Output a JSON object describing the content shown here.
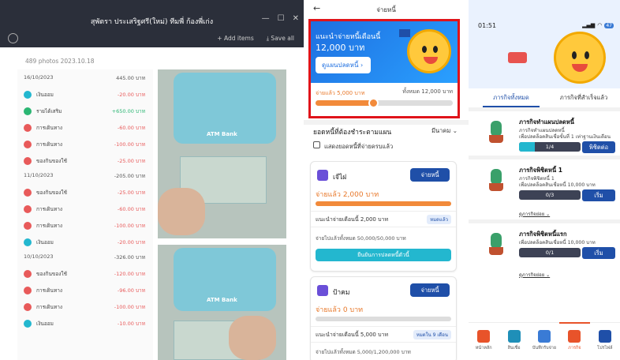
{
  "panel1": {
    "title": "สุพัตรา ประเสริฐศรี(ใหม่) ทีมพี่ ก้องพี่เก่ง",
    "window_controls": [
      "—",
      "☐",
      "✕"
    ],
    "add_items": "+ Add items",
    "save_all": "⤓ Save all",
    "subtitle": "489 photos 2023.10.18",
    "transactions": [
      {
        "kind": "date",
        "date": "16/10/2023",
        "total": "445.00 บาท"
      },
      {
        "kind": "tx",
        "label": "เงินออม",
        "amount": "-20.00 บาท",
        "color": "#23b7cf"
      },
      {
        "kind": "tx",
        "label": "รายได้เสริม",
        "amount": "+650.00 บาท",
        "color": "#2bb673"
      },
      {
        "kind": "tx",
        "label": "การเดินทาง",
        "amount": "-60.00 บาท",
        "color": "#e85a5a"
      },
      {
        "kind": "tx",
        "label": "การเดินทาง",
        "amount": "-100.00 บาท",
        "color": "#e85a5a"
      },
      {
        "kind": "tx",
        "label": "ของกินของใช้",
        "amount": "-25.00 บาท",
        "color": "#e85a5a"
      },
      {
        "kind": "date",
        "date": "11/10/2023",
        "total": "-205.00 บาท"
      },
      {
        "kind": "tx",
        "label": "ของกินของใช้",
        "amount": "-25.00 บาท",
        "color": "#e85a5a"
      },
      {
        "kind": "tx",
        "label": "การเดินทาง",
        "amount": "-60.00 บาท",
        "color": "#e85a5a"
      },
      {
        "kind": "tx",
        "label": "การเดินทาง",
        "amount": "-100.00 บาท",
        "color": "#e85a5a"
      },
      {
        "kind": "tx",
        "label": "เงินออม",
        "amount": "-20.00 บาท",
        "color": "#23b7cf"
      },
      {
        "kind": "date",
        "date": "10/10/2023",
        "total": "-326.00 บาท"
      },
      {
        "kind": "tx",
        "label": "ของกินของใช้",
        "amount": "-120.00 บาท",
        "color": "#e85a5a"
      },
      {
        "kind": "tx",
        "label": "การเดินทาง",
        "amount": "-96.00 บาท",
        "color": "#e85a5a"
      },
      {
        "kind": "tx",
        "label": "การเดินทาง",
        "amount": "-100.00 บาท",
        "color": "#e85a5a"
      },
      {
        "kind": "tx",
        "label": "เงินออม",
        "amount": "-10.00 บาท",
        "color": "#23b7cf"
      }
    ],
    "photo_brand": "ATM Bank"
  },
  "panel2": {
    "back": "←",
    "title": "จ่ายหนี้",
    "hero_heading": "แนะนำจ่ายหนี้เดือนนี้",
    "hero_amount": "12,000 บาท",
    "hero_button": "ดูแผนปลดหนี้ ›",
    "hero_paid": "จ่ายแล้ว 5,000 บาท",
    "hero_total": "ทั้งหมด 12,000 บาท",
    "hero_progress": 0.42,
    "section_title": "ยอดหนี้ที่ต้องชำระตามแผน",
    "month_dropdown": "มีนาคม ⌄",
    "checkbox_label": "แสดงยอดหนี้ที่จ่ายครบแล้ว",
    "debts": [
      {
        "name": "เจ๊ไฝ",
        "pay_button": "จ่ายหนี้",
        "paid": "จ่ายแล้ว 2,000 บาท",
        "progress": 1.0,
        "advice": "แนะนำจ่ายเดือนนี้ 2,000 บาท",
        "tag": "หมดแล้ว",
        "remaining": "จ่ายไปแล้วทั้งหมด 50,000/50,000 บาท",
        "confirm": "ยืนยันการปลดหนี้ตัวนี้"
      },
      {
        "name": "ป้าคม",
        "pay_button": "จ่ายหนี้",
        "paid": "จ่ายแล้ว 0 บาท",
        "progress": 0.0,
        "advice": "แนะนำจ่ายเดือนนี้ 5,000 บาท",
        "tag": "หมดใน 9 เดือน",
        "remaining": "จ่ายไปแล้วทั้งหมด 5,000/1,200,000 บาท"
      }
    ]
  },
  "panel3": {
    "time": "01:51",
    "battery": "47",
    "tabs": [
      "ภารกิจทั้งหมด",
      "ภารกิจที่สำเร็จแล้ว"
    ],
    "missions": [
      {
        "title": "ภารกิจทำแผนปลดหนี้",
        "lines": [
          "ภารกิจทำแผนปลดหนี้",
          "เพื่อปลดล็อคสินเชื่อขั้นที่ 1 เท่าฐานเงินเดือน"
        ],
        "progress_text": "1/4",
        "progress": 0.25,
        "button": "พิชิตต่อ"
      },
      {
        "title": "ภารกิจพิชิตหนี้ 1",
        "lines": [
          "ภารกิจพิชิตหนี้ 1",
          "เพื่อปลดล็อคสินเชื่อหนี้ 10,000 บาท"
        ],
        "progress_text": "0/3",
        "progress": 0.0,
        "button": "เริ่ม",
        "more": "ดูภารกิจย่อย ⌄"
      },
      {
        "title": "ภารกิจพิชิตหนี้แรก",
        "lines": [
          "เพื่อปลดล็อคสินเชื่อหนี้ 10,000 บาท"
        ],
        "progress_text": "0/1",
        "progress": 0.0,
        "button": "เริ่ม",
        "more": "ดูภารกิจย่อย ⌄"
      }
    ],
    "nav": [
      {
        "label": "หน้าหลัก",
        "color": "#e8532a"
      },
      {
        "label": "สินเชื่อ",
        "color": "#1f8fb8"
      },
      {
        "label": "บันทึกรับจ่าย",
        "color": "#3a7bd5"
      },
      {
        "label": "ภารกิจ",
        "color": "#e8532a"
      },
      {
        "label": "โปรไฟล์",
        "color": "#1f4fa8"
      }
    ]
  }
}
